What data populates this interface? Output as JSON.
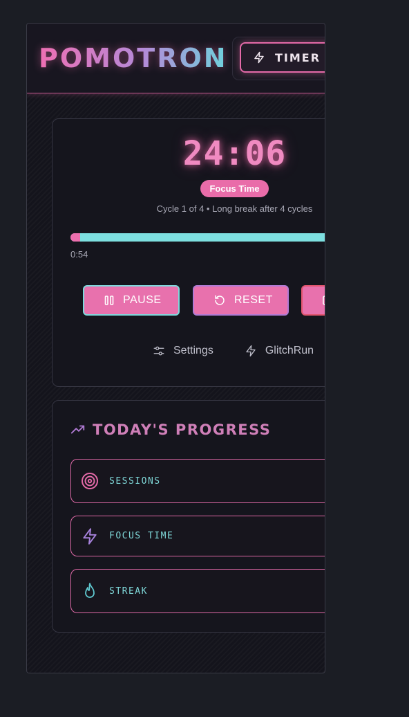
{
  "app": {
    "logo": "POMOTRON"
  },
  "nav": {
    "timer_label": "TIMER"
  },
  "timer": {
    "time": "24:06",
    "mode": "Focus Time",
    "cycle_text": "Cycle 1 of 4 • Long break after 4 cycles",
    "elapsed": "0:54",
    "progress_fraction": 0.036
  },
  "controls": {
    "pause_label": "PAUSE",
    "reset_label": "RESET"
  },
  "links": {
    "settings_label": "Settings",
    "glitchrun_label": "GlitchRun"
  },
  "progress": {
    "title": "TODAY'S PROGRESS",
    "stats": [
      {
        "label": "SESSIONS",
        "icon": "target-icon"
      },
      {
        "label": "FOCUS TIME",
        "icon": "lightning-icon"
      },
      {
        "label": "STREAK",
        "icon": "flame-icon"
      }
    ]
  },
  "colors": {
    "accent_pink": "#e96ca9",
    "accent_cyan": "#7ddfe0",
    "accent_purple": "#b07ad4",
    "background": "#1b1d24"
  }
}
